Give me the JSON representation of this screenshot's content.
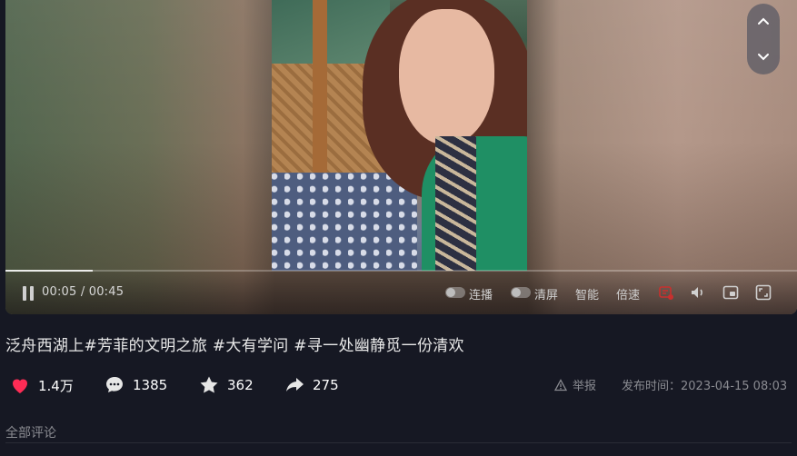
{
  "player": {
    "current_time": "00:05",
    "duration": "00:45",
    "progress": 0.11,
    "controls": {
      "continuous_play": "连播",
      "clear_screen": "清屏",
      "smart": "智能",
      "speed": "倍速"
    }
  },
  "video": {
    "title": "泛舟西湖上#芳菲的文明之旅 #大有学问 #寻一处幽静觅一份清欢"
  },
  "stats": {
    "likes": "1.4万",
    "comments": "1385",
    "favorites": "362",
    "shares": "275"
  },
  "meta": {
    "report_label": "举报",
    "publish_time": "发布时间：2023-04-15 08:03"
  },
  "comments_section": {
    "header": "全部评论"
  },
  "colors": {
    "background": "#161823",
    "like": "#fe2c55",
    "muted_text": "#8a8b91"
  }
}
